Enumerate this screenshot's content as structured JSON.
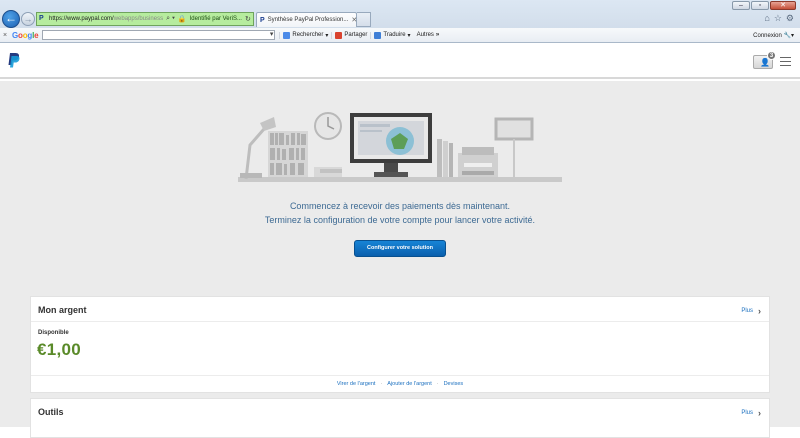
{
  "browser": {
    "address_url_main": "https://www.paypal.com/",
    "address_url_rest": "webapps/business",
    "cert_label": "Identifié par VeriS...",
    "tab_title": "Synthèse PayPal Profession...",
    "window_controls": [
      "minimize-icon",
      "maximize-icon",
      "close-icon"
    ],
    "right_icons": [
      "home-icon",
      "star-icon",
      "gear-icon"
    ]
  },
  "google_toolbar": {
    "close": "×",
    "logo": "Google",
    "search_value": "",
    "rechercher": "Rechercher",
    "partager": "Partager",
    "traduire": "Traduire",
    "autres": "Autres",
    "connexion": "Connexion"
  },
  "paypal": {
    "notification_count": "3"
  },
  "hero": {
    "line1": "Commencez à recevoir des paiements dès maintenant.",
    "line2": "Terminez la configuration de votre compte pour lancer votre activité.",
    "cta": "Configurer votre solution"
  },
  "money": {
    "title": "Mon argent",
    "more": "Plus",
    "available_label": "Disponible",
    "balance": "€1,00",
    "links": [
      "Virer de l'argent",
      "Ajouter de l'argent",
      "Devises"
    ]
  },
  "tools": {
    "title": "Outils",
    "more": "Plus"
  },
  "colors": {
    "accent_blue": "#0a5fad",
    "balance_green": "#5a8a29",
    "hero_bg": "#ebebeb",
    "address_green": "#b6ec9e"
  }
}
